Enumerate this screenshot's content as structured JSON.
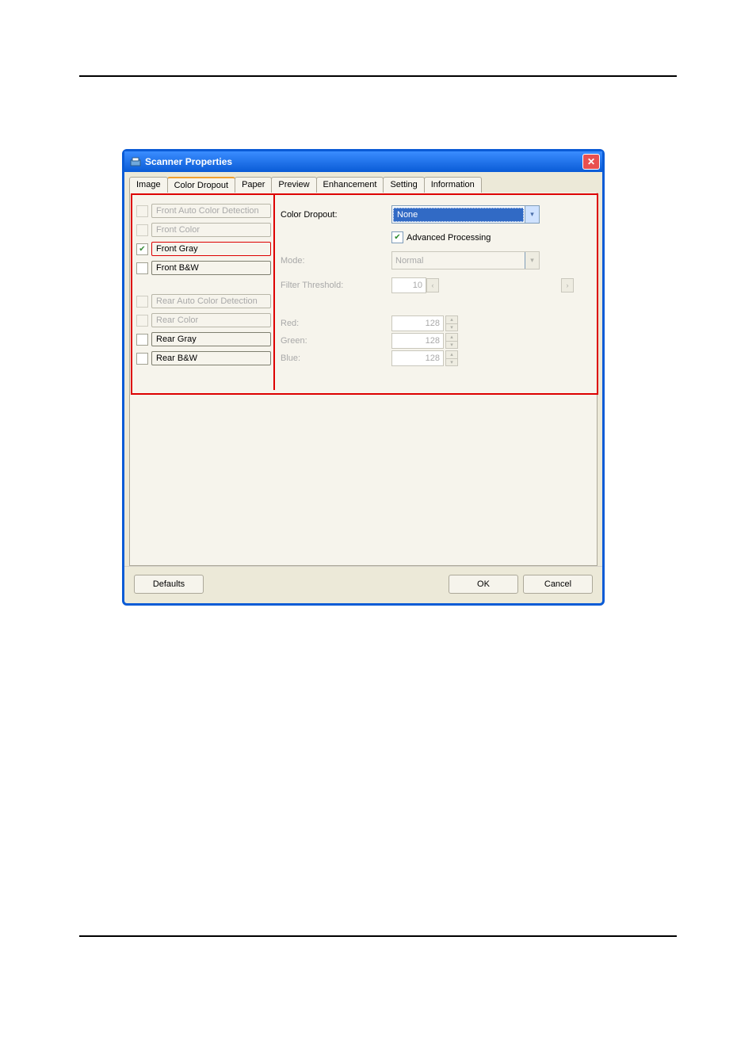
{
  "window": {
    "title": "Scanner Properties"
  },
  "tabs": {
    "items": [
      {
        "label": "Image",
        "active": false
      },
      {
        "label": "Color Dropout",
        "active": true
      },
      {
        "label": "Paper",
        "active": false
      },
      {
        "label": "Preview",
        "active": false
      },
      {
        "label": "Enhancement",
        "active": false
      },
      {
        "label": "Setting",
        "active": false
      },
      {
        "label": "Information",
        "active": false
      }
    ]
  },
  "side_selection": {
    "front": [
      {
        "label": "Front Auto Color Detection",
        "checked": false,
        "enabled": false
      },
      {
        "label": "Front Color",
        "checked": false,
        "enabled": false
      },
      {
        "label": "Front Gray",
        "checked": true,
        "enabled": true,
        "highlighted": true
      },
      {
        "label": "Front B&W",
        "checked": false,
        "enabled": true
      }
    ],
    "rear": [
      {
        "label": "Rear Auto Color Detection",
        "checked": false,
        "enabled": false
      },
      {
        "label": "Rear Color",
        "checked": false,
        "enabled": false
      },
      {
        "label": "Rear Gray",
        "checked": false,
        "enabled": true
      },
      {
        "label": "Rear B&W",
        "checked": false,
        "enabled": true
      }
    ]
  },
  "dropout": {
    "color_dropout_label": "Color Dropout:",
    "color_dropout_value": "None",
    "advanced_processing_label": "Advanced Processing",
    "advanced_processing_checked": true,
    "mode_label": "Mode:",
    "mode_value": "Normal",
    "filter_threshold_label": "Filter Threshold:",
    "filter_threshold_value": "10",
    "red_label": "Red:",
    "red_value": "128",
    "green_label": "Green:",
    "green_value": "128",
    "blue_label": "Blue:",
    "blue_value": "128"
  },
  "buttons": {
    "defaults": "Defaults",
    "ok": "OK",
    "cancel": "Cancel"
  }
}
